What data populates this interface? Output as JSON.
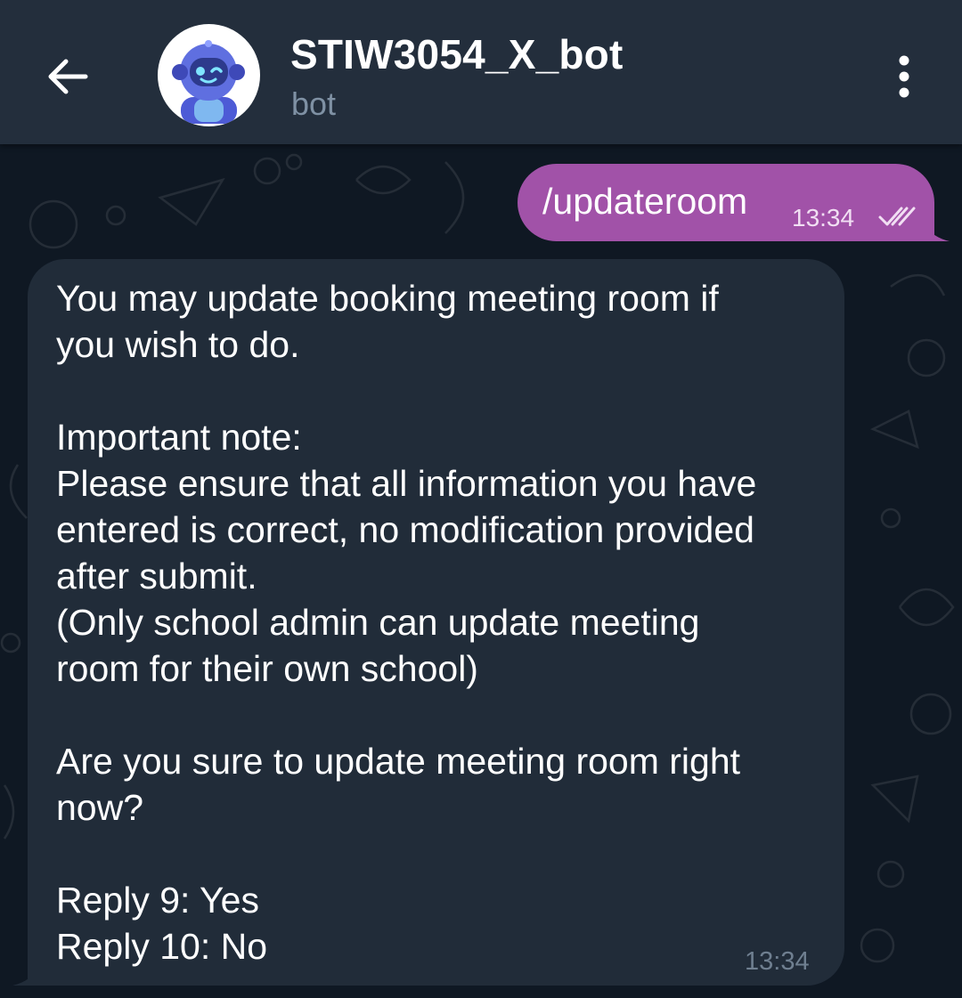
{
  "header": {
    "title": "STIW3054_X_bot",
    "subtitle": "bot",
    "back_icon": "arrow-left-icon",
    "menu_icon": "more-vertical-icon",
    "avatar_icon": "robot-avatar-icon"
  },
  "messages": {
    "outgoing": {
      "text": "/updateroom",
      "time": "13:34",
      "status_icon": "double-check-icon"
    },
    "incoming": {
      "lines": [
        "You may update booking meeting room if",
        "you wish to do.",
        "",
        "Important note:",
        "Please ensure that all information you have",
        "entered is correct, no modification provided",
        "after submit.",
        "(Only school admin can update meeting",
        "room for their own school)",
        "",
        "Are you sure to update meeting room right",
        "now?",
        "",
        "Reply 9: Yes",
        "Reply 10: No"
      ],
      "time": "13:34"
    }
  },
  "colors": {
    "header_bg": "#232e3c",
    "chat_bg": "#0f1823",
    "outgoing_bubble": "#a152a8",
    "incoming_bubble": "#212c39",
    "subtitle": "#7f91a4"
  }
}
